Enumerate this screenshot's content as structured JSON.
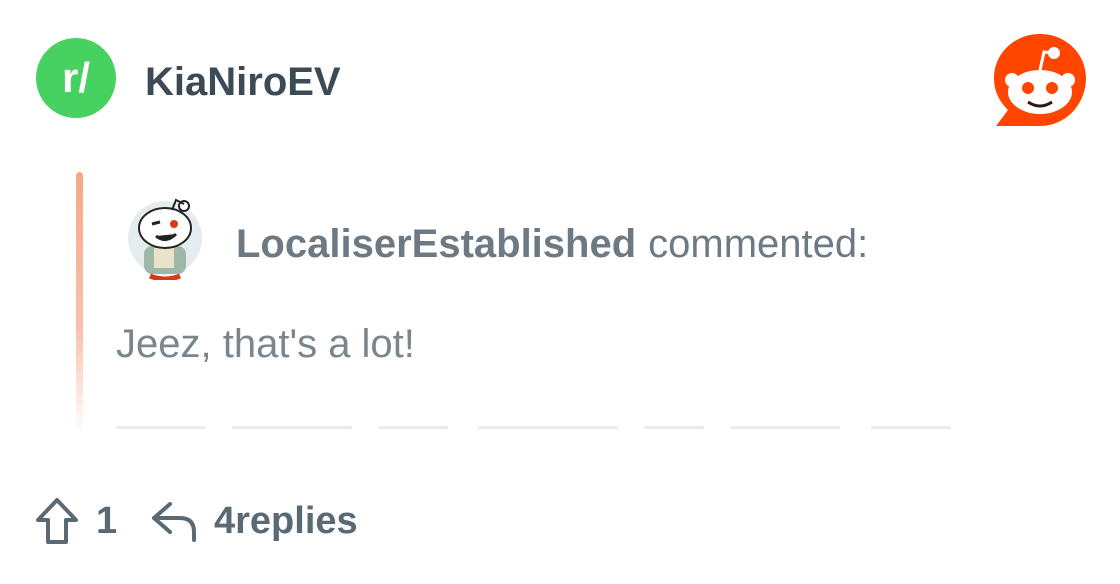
{
  "header": {
    "subreddit_icon_text": "r/",
    "subreddit_name": "KiaNiroEV",
    "brand_colors": {
      "subreddit_green": "#46d160",
      "reddit_orange": "#ff4500"
    }
  },
  "comment": {
    "username": "LocaliserEstablished",
    "verb": "commented:",
    "body": "Jeez, that's a lot!",
    "thread_line_color": "#f4a88a"
  },
  "footer": {
    "upvote_icon": "arrow-up-icon",
    "score": "1",
    "reply_icon": "reply-arrow-icon",
    "replies_label": "4replies"
  }
}
